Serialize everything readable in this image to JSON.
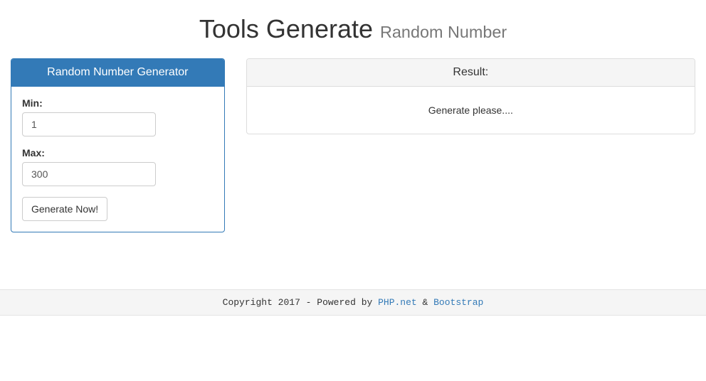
{
  "header": {
    "title_main": "Tools Generate",
    "title_sub": "Random Number"
  },
  "generator_panel": {
    "heading": "Random Number Generator",
    "min_label": "Min:",
    "min_value": "1",
    "max_label": "Max:",
    "max_value": "300",
    "button_label": "Generate Now!"
  },
  "result_panel": {
    "heading": "Result:",
    "body_text": "Generate please...."
  },
  "footer": {
    "copyright": "Copyright 2017 - Powered by ",
    "link1_text": "PHP.net",
    "separator": " & ",
    "link2_text": "Bootstrap"
  }
}
